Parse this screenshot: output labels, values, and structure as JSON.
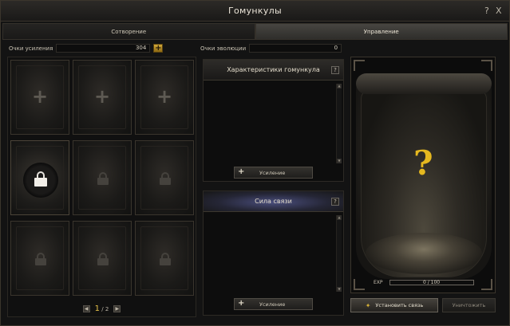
{
  "window": {
    "title": "Гомункулы",
    "help_label": "?",
    "close_label": "X"
  },
  "tabs": [
    {
      "label": "Сотворение",
      "active": false
    },
    {
      "label": "Управление",
      "active": true
    }
  ],
  "points": {
    "enhance_label": "Очки усиления",
    "enhance_value": "304",
    "add_label": "+",
    "evolution_label": "Очки эволюции",
    "evolution_value": "0"
  },
  "slots": [
    {
      "state": "add",
      "glyph": "+"
    },
    {
      "state": "add",
      "glyph": "+"
    },
    {
      "state": "add",
      "glyph": "+"
    },
    {
      "state": "locked-active"
    },
    {
      "state": "locked"
    },
    {
      "state": "locked"
    },
    {
      "state": "locked"
    },
    {
      "state": "locked"
    },
    {
      "state": "locked"
    }
  ],
  "pager": {
    "prev_label": "◀",
    "current": "1",
    "sep": "/",
    "total": "2",
    "next_label": "▶"
  },
  "stats_panel": {
    "title": "Характеристики гомункула",
    "help_label": "?",
    "boost_label": "Усиление",
    "boost_icon": "plus-icon"
  },
  "bond_panel": {
    "title": "Сила связи",
    "help_label": "?",
    "boost_label": "Усиление",
    "boost_icon": "plus-icon"
  },
  "jar": {
    "glyph": "?",
    "exp_label": "EXP",
    "exp_value": "0 / 100",
    "exp_fraction": 0
  },
  "actions": {
    "link_label": "Установить связь",
    "link_icon": "bond-icon",
    "destroy_label": "Уничтожить"
  },
  "colors": {
    "accent": "#e5b81f",
    "plus_button": "#c9a033"
  }
}
